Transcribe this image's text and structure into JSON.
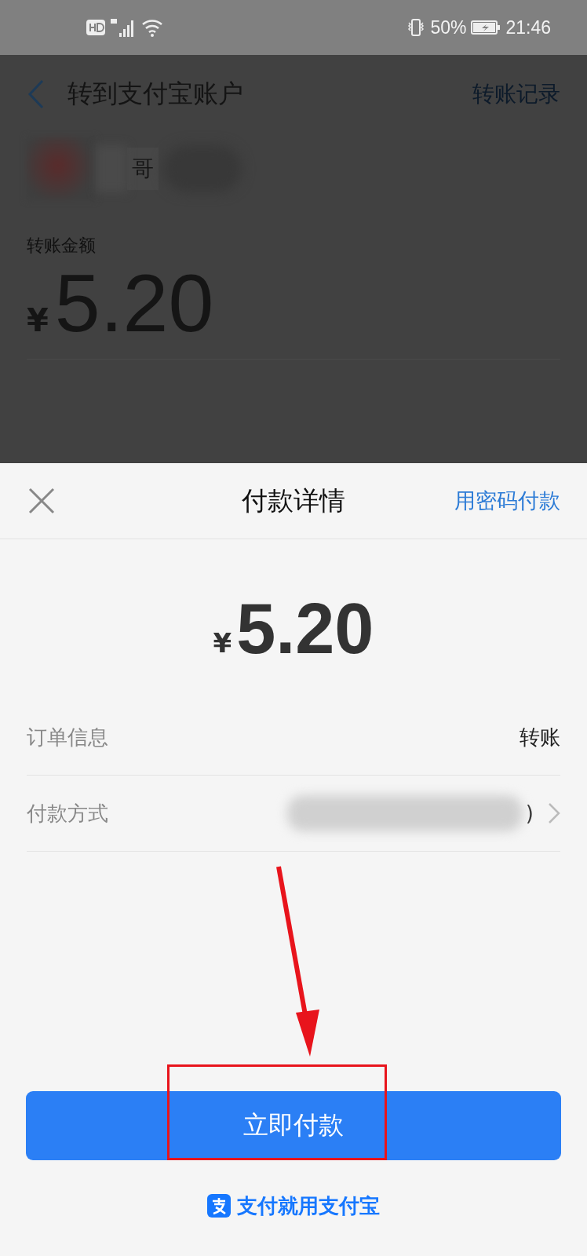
{
  "status_bar": {
    "battery": "50%",
    "time": "21:46"
  },
  "header": {
    "title": "转到支付宝账户",
    "link": "转账记录"
  },
  "recipient": {
    "name": "哥"
  },
  "amount_label": "转账金额",
  "amount": {
    "currency": "¥",
    "value": "5.20"
  },
  "sheet": {
    "title": "付款详情",
    "link": "用密码付款",
    "amount": {
      "currency": "¥",
      "value": "5.20"
    },
    "rows": [
      {
        "kind": "text",
        "label": "订单信息",
        "value": "转账"
      },
      {
        "kind": "select",
        "label": "付款方式",
        "value": ")"
      }
    ],
    "pay_button": "立即付款",
    "brand": "支付就用支付宝"
  }
}
